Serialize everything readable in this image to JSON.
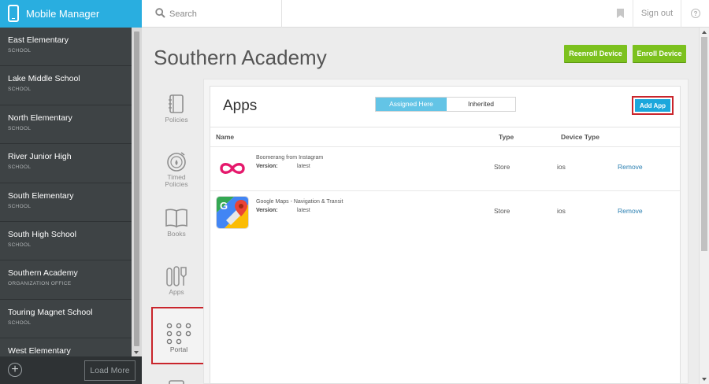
{
  "app": {
    "title": "Mobile Manager"
  },
  "search": {
    "placeholder": "Search"
  },
  "header": {
    "sign_out": "Sign out",
    "help_glyph": "?"
  },
  "sidebar": {
    "schools": [
      {
        "name": "East Elementary",
        "type": "SCHOOL"
      },
      {
        "name": "Lake Middle School",
        "type": "SCHOOL"
      },
      {
        "name": "North Elementary",
        "type": "SCHOOL"
      },
      {
        "name": "River Junior High",
        "type": "SCHOOL"
      },
      {
        "name": "South Elementary",
        "type": "SCHOOL"
      },
      {
        "name": "South High School",
        "type": "SCHOOL"
      },
      {
        "name": "Southern Academy",
        "type": "ORGANIZATION OFFICE"
      },
      {
        "name": "Touring Magnet School",
        "type": "SCHOOL"
      },
      {
        "name": "West Elementary",
        "type": ""
      }
    ],
    "load_more": "Load More"
  },
  "page": {
    "title": "Southern Academy",
    "reenroll_button": "Reenroll Device",
    "enroll_button": "Enroll Device"
  },
  "nav": {
    "policies": "Policies",
    "timed_policies": "Timed Policies",
    "books": "Books",
    "apps": "Apps",
    "portal": "Portal"
  },
  "apps_panel": {
    "title": "Apps",
    "tab_assigned": "Assigned Here",
    "tab_inherited": "Inherited",
    "add_app": "Add App",
    "columns": {
      "name": "Name",
      "type": "Type",
      "device_type": "Device Type"
    },
    "rows": [
      {
        "name": "Boomerang from Instagram",
        "version_label": "Version:",
        "version": "latest",
        "type": "Store",
        "device_type": "ios",
        "action": "Remove"
      },
      {
        "name": "Google Maps - Navigation & Transit",
        "version_label": "Version:",
        "version": "latest",
        "type": "Store",
        "device_type": "ios",
        "action": "Remove"
      }
    ]
  },
  "colors": {
    "brand": "#29aee0",
    "sidebar": "#3e4345",
    "green_button": "#7cc11e",
    "highlight": "#c9252c",
    "boomerang": "#e5196c"
  },
  "icons": [
    "phone-icon",
    "search-icon",
    "bookmark-icon",
    "help-icon",
    "add-circle-icon",
    "policies-icon",
    "timer-icon",
    "book-icon",
    "apps-tools-icon",
    "portal-grid-icon",
    "boomerang-logo-icon",
    "google-maps-logo-icon"
  ]
}
